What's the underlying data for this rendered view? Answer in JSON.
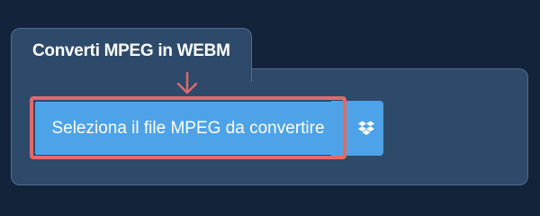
{
  "converter": {
    "title": "Converti MPEG in WEBM",
    "select_file_label": "Seleziona il file MPEG da convertire",
    "dropbox_icon": "dropbox-icon",
    "pointer_icon": "arrow-down-icon"
  },
  "colors": {
    "page_background": "#13233a",
    "panel_background": "#2e4a6b",
    "panel_border": "#4e6d8e",
    "button_background": "#4ea3e8",
    "highlight": "#e06a6a"
  }
}
